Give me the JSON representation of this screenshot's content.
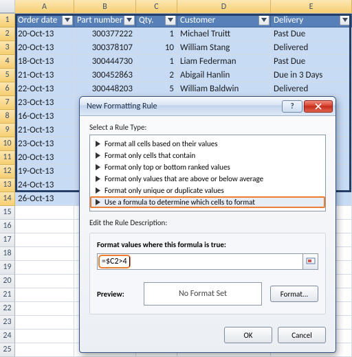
{
  "columns": [
    "A",
    "B",
    "C",
    "D",
    "E"
  ],
  "headers": {
    "A": "Order date",
    "B": "Part number",
    "C": "Qty.",
    "D": "Customer",
    "E": "Delivery"
  },
  "rows": [
    {
      "n": 1
    },
    {
      "n": 2,
      "A": "20-Oct-13",
      "B": "300377222",
      "C": "1",
      "D": "Michael Truitt",
      "E": "Past Due"
    },
    {
      "n": 3,
      "A": "20-Oct-13",
      "B": "300378107",
      "C": "10",
      "D": "William Stang",
      "E": "Delivered"
    },
    {
      "n": 4,
      "A": "18-Oct-13",
      "B": "300444730",
      "C": "1",
      "D": "Liam Federman",
      "E": "Past Due"
    },
    {
      "n": 5,
      "A": "21-Oct-13",
      "B": "300452863",
      "C": "2",
      "D": "Abigail Hanlin",
      "E": "Due in 3 Days"
    },
    {
      "n": 6,
      "A": "22-Oct-13",
      "B": "300448203",
      "C": "5",
      "D": "William Baldwin",
      "E": "Delivered"
    },
    {
      "n": 7,
      "A": "23-Oct-13"
    },
    {
      "n": 8,
      "A": "16-Oct-13"
    },
    {
      "n": 9,
      "A": "21-Oct-13"
    },
    {
      "n": 10,
      "A": "23-Oct-13"
    },
    {
      "n": 11,
      "A": "20-Oct-13"
    },
    {
      "n": 12,
      "A": "19-Oct-13"
    },
    {
      "n": 13,
      "A": "24-Oct-13"
    },
    {
      "n": 14,
      "A": "26-Oct-13"
    },
    {
      "n": 15
    },
    {
      "n": 16
    },
    {
      "n": 17
    },
    {
      "n": 18
    },
    {
      "n": 19
    },
    {
      "n": 20
    },
    {
      "n": 21
    },
    {
      "n": 22
    },
    {
      "n": 23
    },
    {
      "n": 24
    },
    {
      "n": 25
    }
  ],
  "dialog": {
    "title": "New Formatting Rule",
    "select_label": "Select a Rule Type:",
    "rules": [
      "Format all cells based on their values",
      "Format only cells that contain",
      "Format only top or bottom ranked values",
      "Format only values that are above or below average",
      "Format only unique or duplicate values",
      "Use a formula to determine which cells to format"
    ],
    "edit_label": "Edit the Rule Description:",
    "formula_label": "Format values where this formula is true:",
    "formula_value": "=$C2>4",
    "preview_label": "Preview:",
    "preview_text": "No Format Set",
    "format_btn": "Format...",
    "ok": "OK",
    "cancel": "Cancel"
  }
}
